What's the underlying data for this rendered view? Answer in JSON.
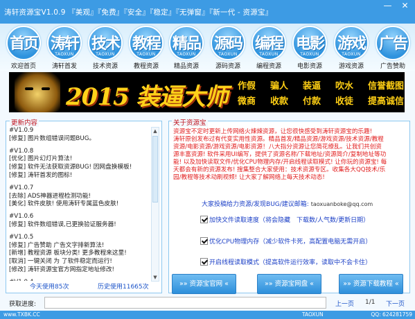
{
  "app": {
    "title": "涛轩资源宝V1.0.9  『美观』『免费』『安全』『稳定』『无弹窗』『新一代 - 资源宝』",
    "min": "—",
    "close": "✕"
  },
  "nav": [
    {
      "big": "首页",
      "sub": "",
      "label": "欢迎首页",
      "icon": "home-icon"
    },
    {
      "big": "涛轩",
      "sub": "TAOXUN",
      "label": "涛轩首发",
      "icon": "taoxuan-icon"
    },
    {
      "big": "技术",
      "sub": "TAOXUN",
      "label": "技术资源",
      "icon": "tech-icon"
    },
    {
      "big": "教程",
      "sub": "TAOXUN",
      "label": "教程资源",
      "icon": "tutorial-icon"
    },
    {
      "big": "精品",
      "sub": "TAOXUN",
      "label": "精品资源",
      "icon": "premium-icon"
    },
    {
      "big": "源码",
      "sub": "TAOXUN",
      "label": "源码资源",
      "icon": "source-code-icon"
    },
    {
      "big": "编程",
      "sub": "TAOXUN",
      "label": "编程资源",
      "icon": "programming-icon"
    },
    {
      "big": "电影",
      "sub": "TAOXUN",
      "label": "电影资源",
      "icon": "movie-icon"
    },
    {
      "big": "游戏",
      "sub": "TAOXUN",
      "label": "游戏资源",
      "icon": "game-icon"
    },
    {
      "big": "广告",
      "sub": "",
      "label": "广告赞助",
      "icon": "ad-icon"
    }
  ],
  "banner": {
    "title": "2015 装逼大师",
    "row1": [
      "作假",
      "骗人",
      "装逼",
      "吹水",
      "信誉截图"
    ],
    "row2": [
      "微商",
      "收款",
      "付款",
      "收徒",
      "提高诚信"
    ]
  },
  "updates": {
    "legend": "更新内容",
    "lines": [
      "#V1.0.9",
      "[修复] 图片数组错误问题BUG。",
      "",
      "#V1.0.8",
      "[优化] 图片幻灯片算法!",
      "[修复] 软件无法获取资源BUG! 因网盘换模板!",
      "[修复] 涛轩首发的图标!",
      "",
      "#V1.0.7",
      "[去除] ADS神器进程检测功能!",
      "[美化] 软件皮肤! 使用涛轩专属蓝色皮肤!",
      "",
      "#V1.0.6",
      "[修复] 软件数组错误,已更换验证服务器!",
      "",
      "#V1.0.5",
      "[修复] 广告赞助 广告文字排新算法!",
      "[新增] 教程资源 板块分类! 更多教程来这里!",
      "[取消] 一键关闭 为 了软件稳定而运行!",
      "[修改] 涛轩资源宝官方网指定地址修改!",
      "",
      "#V1.0.4"
    ],
    "today": "今天使用85次",
    "history": "历史使用11665次"
  },
  "about": {
    "legend": "关于资源宝",
    "lines": [
      "资源宝不定时更新上传网络火辣辣资源，让您很快感受到涛轩资源宝的乐趣!",
      "涛轩原创发布过有代变实用性资源。精品首发/精品资源/游戏资源/技术资源/教程",
      "资源/电影资源/游戏资源/电影资源！八大指分资源让您简花缭乱。让我们共创资",
      "源丰富资源! 软件采用UI编写，提供了资源名称/下载地址/资源简介/复制地址等功",
      "能! 以及加快读取文件/优化CPU物理内存/开启线程读取模式! 让你玩的资源宝! 每",
      "天都会有新的资源发布! 搜集整合大家使用：技术资源专区。收集各大QQ技术/乐",
      "园/教程等技术动刷视频! 让大家了解网络上每天技术动态!"
    ],
    "contact": "大家投稿给力资源/发现BUG/建议邮箱:",
    "email": "taoxuanboke@qq.com",
    "options": [
      "加快文件读取速度（将会隐藏　下载数/人气数/更新日期）",
      "优化CPU物理内存（减少软件卡死，高配置电脑无需开启）",
      "开启线程读取模式（提高软件运行效率，读取中不会卡住）"
    ],
    "buttons": [
      "»» 资源宝官网 «",
      "»» 资源宝网盘 «",
      "»» 资源下载教程 «"
    ]
  },
  "bottom": {
    "progress_label": "获取进度:",
    "prev": "上一页",
    "page": "1/1",
    "next": "下一页"
  },
  "status": {
    "left": "www.TXBK.CC",
    "mid": "TAOXUN",
    "right": "QQ: 624281759"
  }
}
